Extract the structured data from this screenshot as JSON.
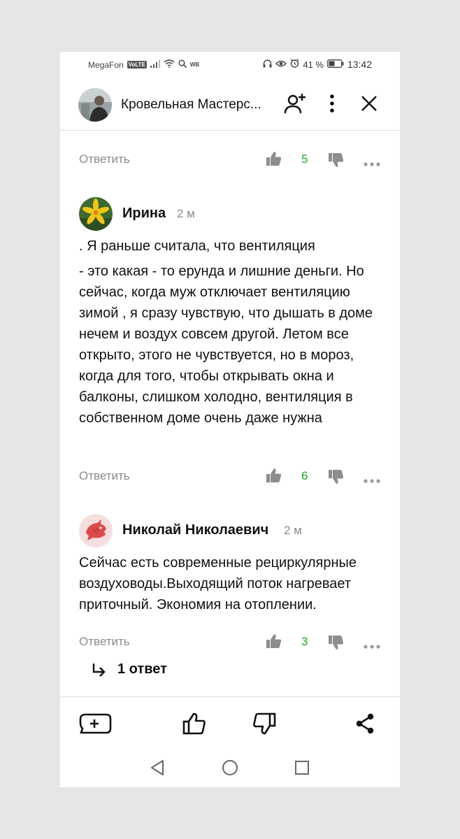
{
  "status_bar": {
    "carrier": "MegaFon",
    "volte": "VoLTE",
    "wb": "WB",
    "battery_percent": "41 %",
    "time": "13:42"
  },
  "header": {
    "title": "Кровельная Мастерс..."
  },
  "feed": {
    "top_actions": {
      "reply_label": "Ответить",
      "likes": "5"
    },
    "comments": [
      {
        "author": "Ирина",
        "time_ago": "2 м",
        "paragraphs": [
          ". Я раньше считала, что вентиляция",
          "- это какая - то ерунда и лишние деньги. Но сейчас, когда муж отключает вентиляцию зимой , я сразу чувствую, что дышать в доме нечем и воздух совсем другой. Летом все открыто, этого не чувствуется, но в мороз, когда для того, чтобы открывать окна и балконы, слишком холодно, вентиляция в собственном доме очень даже нужна"
        ],
        "reply_label": "Ответить",
        "likes": "6"
      },
      {
        "author": "Николай Николаевич",
        "time_ago": "2 м",
        "paragraphs": [
          "Сейчас есть современные рециркулярные воздуховоды.Выходящий поток нагревает приточный. Экономия на отоплении."
        ],
        "reply_label": "Ответить",
        "likes": "3",
        "replies_label": "1 ответ"
      }
    ]
  },
  "colors": {
    "like_count": "#1fa51f",
    "muted_text": "#8a8a8a",
    "divider": "#dddddd"
  }
}
